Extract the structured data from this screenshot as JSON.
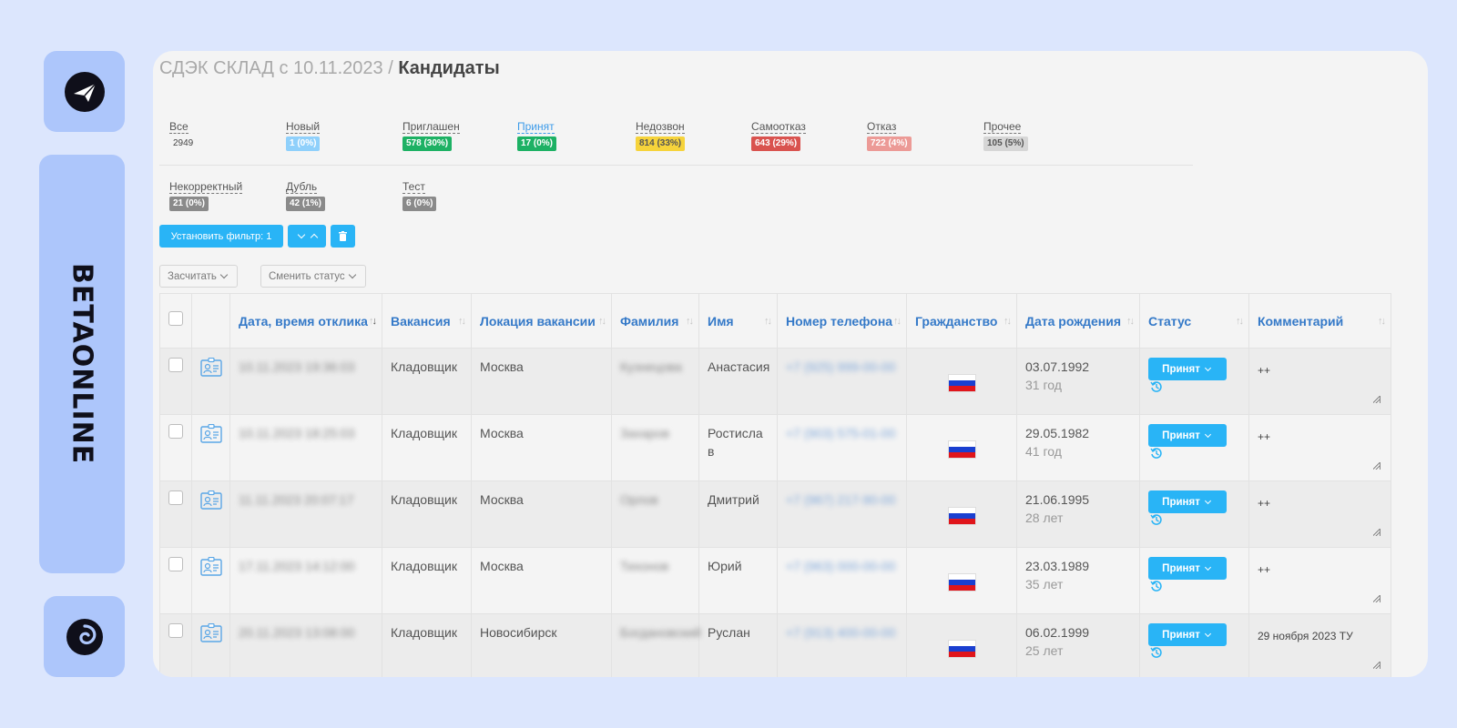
{
  "brand": {
    "name": "BETAONLINE"
  },
  "breadcrumb": {
    "parent": "СДЭК СКЛАД с 10.11.2023",
    "separator": "/",
    "current": "Кандидаты"
  },
  "stats": [
    {
      "label": "Все",
      "count": "2949",
      "color": ""
    },
    {
      "label": "Новый",
      "count": "1 (0%)",
      "color": "#8fd0fb"
    },
    {
      "label": "Приглашен",
      "count": "578 (30%)",
      "color": "#1db164"
    },
    {
      "label": "Принят",
      "count": "17 (0%)",
      "color": "#1db164"
    },
    {
      "label": "Недозвон",
      "count": "814 (33%)",
      "color": "#f6d33b"
    },
    {
      "label": "Самоотказ",
      "count": "643 (29%)",
      "color": "#d9534f"
    },
    {
      "label": "Отказ",
      "count": "722 (4%)",
      "color": "#ec9a96"
    },
    {
      "label": "Прочее",
      "count": "105 (5%)",
      "color": "#d6d6d6"
    },
    {
      "label": "Некорректный",
      "count": "21 (0%)",
      "color": "#8a8a8a"
    },
    {
      "label": "Дубль",
      "count": "42 (1%)",
      "color": "#8a8a8a"
    },
    {
      "label": "Тест",
      "count": "6 (0%)",
      "color": "#8a8a8a"
    }
  ],
  "toolbar": {
    "filter_label": "Установить фильтр: 1",
    "count_label": "Засчитать",
    "change_status_label": "Сменить статус"
  },
  "table": {
    "headers": [
      "Дата, время отклика",
      "Вакансия",
      "Локация вакансии",
      "Фамилия",
      "Имя",
      "Номер телефона",
      "Гражданство",
      "Дата рождения",
      "Статус",
      "Комментарий"
    ],
    "rows": [
      {
        "datetime": "10.11.2023 19:36:03",
        "vacancy": "Кладовщик",
        "location": "Москва",
        "surname": "Кузнецова",
        "name": "Анастасия",
        "phone": "+7 (925) 999-00-00",
        "birth": "03.07.1992",
        "age": "31 год",
        "status": "Принят",
        "comment": "++"
      },
      {
        "datetime": "10.11.2023 18:25:03",
        "vacancy": "Кладовщик",
        "location": "Москва",
        "surname": "Захаров",
        "name": "Ростисла в",
        "phone": "+7 (903) 575-01-00",
        "birth": "29.05.1982",
        "age": "41 год",
        "status": "Принят",
        "comment": "++"
      },
      {
        "datetime": "11.11.2023 20:07:17",
        "vacancy": "Кладовщик",
        "location": "Москва",
        "surname": "Орлов",
        "name": "Дмитрий",
        "phone": "+7 (967) 217-90-00",
        "birth": "21.06.1995",
        "age": "28 лет",
        "status": "Принят",
        "comment": "++"
      },
      {
        "datetime": "17.11.2023 14:12:00",
        "vacancy": "Кладовщик",
        "location": "Москва",
        "surname": "Тихонов",
        "name": "Юрий",
        "phone": "+7 (963) 000-00-00",
        "birth": "23.03.1989",
        "age": "35 лет",
        "status": "Принят",
        "comment": "++"
      },
      {
        "datetime": "20.11.2023 13:08:00",
        "vacancy": "Кладовщик",
        "location": "Новосибирск",
        "surname": "Богдановский",
        "name": "Руслан",
        "phone": "+7 (913) 400-00-00",
        "birth": "06.02.1999",
        "age": "25 лет",
        "status": "Принят",
        "comment": "29 ноября 2023 ТУ"
      }
    ]
  },
  "colors": {
    "accent": "#29b4f6",
    "header_text": "#3479c8",
    "tile": "#adc6fb",
    "background": "#dce6fd"
  }
}
